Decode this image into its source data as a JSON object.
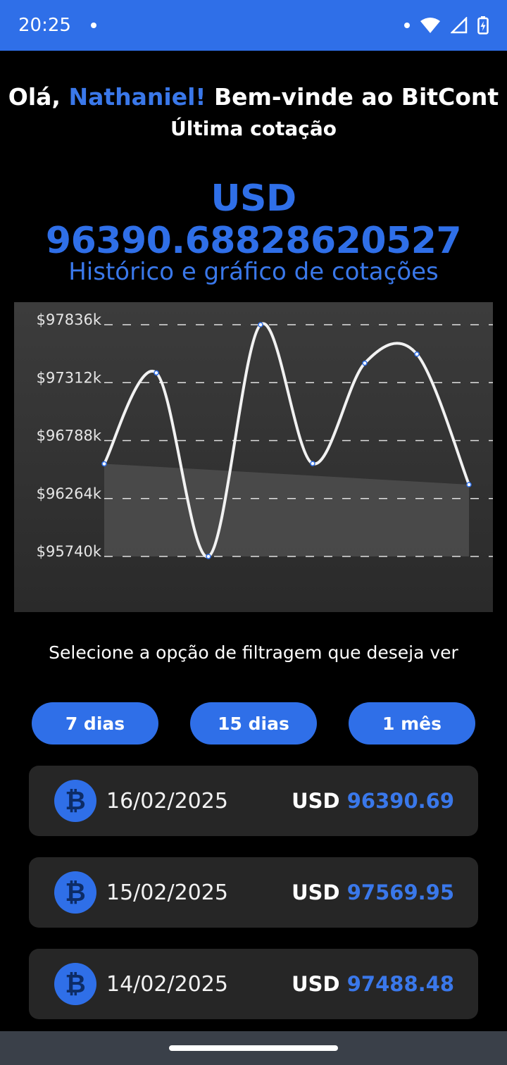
{
  "status_bar": {
    "time": "20:25"
  },
  "header": {
    "greeting_prefix": "Olá, ",
    "user_name": "Nathaniel!",
    "greeting_suffix": " Bem-vinde ao BitCont",
    "subtitle": "Última cotação"
  },
  "latest_price": "USD 96390.68828620527",
  "history_title": "Histórico e gráfico de cotações",
  "chart_data": {
    "type": "area",
    "title": "",
    "xlabel": "",
    "ylabel": "",
    "y_ticks": [
      "$97836k",
      "$97312k",
      "$96788k",
      "$96264k",
      "$95740k"
    ],
    "ylim": [
      95740,
      97836
    ],
    "grid": true,
    "series": [
      {
        "values": [
          96578,
          97400,
          95740,
          97836,
          96580,
          97488,
          97570,
          96390
        ]
      }
    ],
    "colors": {
      "line": "#f2f2f2",
      "fill": "#4d4d4d",
      "points": "#2f6fe8",
      "grid": "#e0e0e0"
    }
  },
  "filter": {
    "prompt": "Selecione a opção de filtragem que deseja ver",
    "options": [
      "7 dias",
      "15 dias",
      "1 mês"
    ]
  },
  "quotes": [
    {
      "date": "16/02/2025",
      "currency": "USD",
      "value": "96390.69"
    },
    {
      "date": "15/02/2025",
      "currency": "USD",
      "value": "97569.95"
    },
    {
      "date": "14/02/2025",
      "currency": "USD",
      "value": "97488.48"
    }
  ],
  "icons": {
    "status": [
      "dot-icon",
      "wifi-icon",
      "signal-icon",
      "battery-charging-icon"
    ],
    "coin": "bitcoin-icon"
  },
  "colors": {
    "accent": "#2f6fe8",
    "background": "#000000",
    "card": "#262626",
    "nav": "#3a4049"
  }
}
